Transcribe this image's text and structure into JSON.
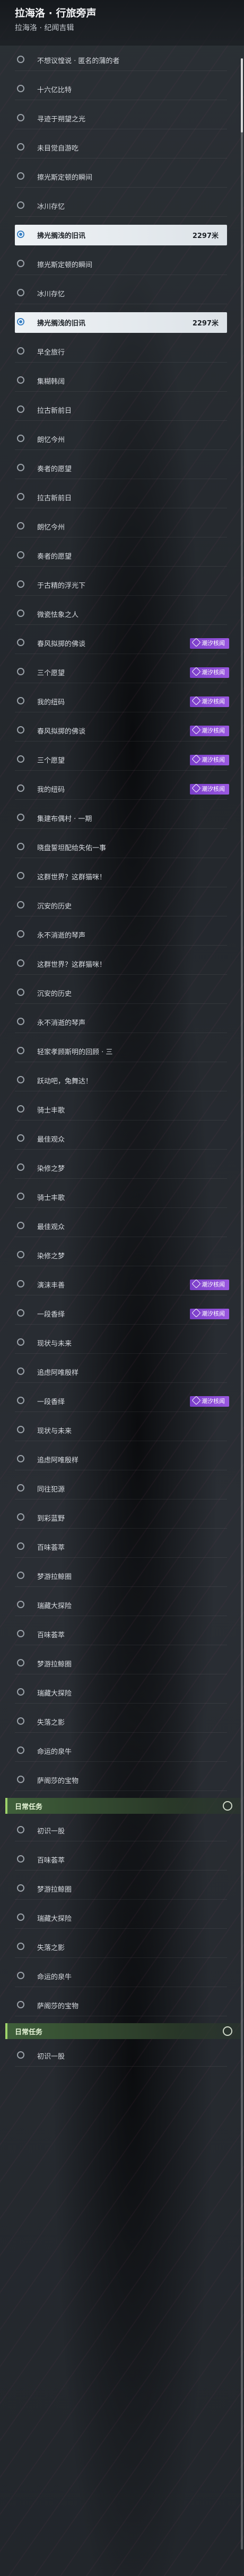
{
  "header": {
    "title": "拉海洛 · 行旅旁声",
    "subtitle": "拉海洛 · 纪闻吉辑"
  },
  "colors": {
    "selected_radio": "#3b82c4",
    "badge": "#8a4bd6",
    "section_accent": "#9fd36b"
  },
  "items": [
    {
      "type": "item",
      "label": "不想议惶说 · 匿名的蒲的者"
    },
    {
      "type": "item",
      "label": "十六亿比特"
    },
    {
      "type": "item",
      "label": "寻迹于朔望之光"
    },
    {
      "type": "item",
      "label": "未目觉自游吃"
    },
    {
      "type": "item",
      "label": "擦光斯定顿的瞬间"
    },
    {
      "type": "item",
      "label": "冰川存忆"
    },
    {
      "type": "item",
      "label": "拂光搁浅的旧讯",
      "selected": true,
      "distance": "2297米"
    },
    {
      "type": "item",
      "label": "擦光斯定顿的瞬间"
    },
    {
      "type": "item",
      "label": "冰川存忆"
    },
    {
      "type": "item",
      "label": "拂光搁浅的旧讯",
      "selected": true,
      "distance": "2297米"
    },
    {
      "type": "item",
      "label": "早全旅行"
    },
    {
      "type": "item",
      "label": "集糊韩阔"
    },
    {
      "type": "item",
      "label": "拉古新前日"
    },
    {
      "type": "item",
      "label": "朗忆今州"
    },
    {
      "type": "item",
      "label": "奏者的愿望"
    },
    {
      "type": "item",
      "label": "拉古新前日"
    },
    {
      "type": "item",
      "label": "朗忆今州"
    },
    {
      "type": "item",
      "label": "奏者的愿望"
    },
    {
      "type": "item",
      "label": "于古精的浮光下"
    },
    {
      "type": "item",
      "label": "微瓷怯象之人"
    },
    {
      "type": "item",
      "label": "春风拟掷的佛谈",
      "badge": "潮汐核闻"
    },
    {
      "type": "item",
      "label": "三个愿望",
      "badge": "潮汐核闻"
    },
    {
      "type": "item",
      "label": "我的纽码",
      "badge": "潮汐核闻"
    },
    {
      "type": "item",
      "label": "春风拟掷的佛谈",
      "badge": "潮汐核闻"
    },
    {
      "type": "item",
      "label": "三个愿望",
      "badge": "潮汐核闻"
    },
    {
      "type": "item",
      "label": "我的纽码",
      "badge": "潮汐核闻"
    },
    {
      "type": "item",
      "label": "集建布偶村 · 一期"
    },
    {
      "type": "item",
      "label": "晓盘誓坦配给失佑一事"
    },
    {
      "type": "item",
      "label": "这群世界？这群猫咪！"
    },
    {
      "type": "item",
      "label": "沉安的历史"
    },
    {
      "type": "item",
      "label": "永不消逝的琴声"
    },
    {
      "type": "item",
      "label": "这群世界？这群猫咪！"
    },
    {
      "type": "item",
      "label": "沉安的历史"
    },
    {
      "type": "item",
      "label": "永不消逝的琴声"
    },
    {
      "type": "item",
      "label": "轻家孝顾斯明的回顾 · 三"
    },
    {
      "type": "item",
      "label": "跃动吧，兔舞达！"
    },
    {
      "type": "item",
      "label": "骑士丰歌"
    },
    {
      "type": "item",
      "label": "最佳观众"
    },
    {
      "type": "item",
      "label": "染修之梦"
    },
    {
      "type": "item",
      "label": "骑士丰歌"
    },
    {
      "type": "item",
      "label": "最佳观众"
    },
    {
      "type": "item",
      "label": "染修之梦"
    },
    {
      "type": "item",
      "label": "演沫丰善",
      "badge": "潮汐核闻"
    },
    {
      "type": "item",
      "label": "一段香绎",
      "badge": "潮汐核闻"
    },
    {
      "type": "item",
      "label": "现状与未来"
    },
    {
      "type": "item",
      "label": "追虑阿唯殷样"
    },
    {
      "type": "item",
      "label": "一段香绎",
      "badge": "潮汐核闻"
    },
    {
      "type": "item",
      "label": "现状与未来"
    },
    {
      "type": "item",
      "label": "追虑阿唯殷样"
    },
    {
      "type": "item",
      "label": "同往犯源"
    },
    {
      "type": "item",
      "label": "到彩蓝野"
    },
    {
      "type": "item",
      "label": "百味荟萃"
    },
    {
      "type": "item",
      "label": "梦游拉鲸圈"
    },
    {
      "type": "item",
      "label": "瑞藏大探险"
    },
    {
      "type": "item",
      "label": "百味荟萃"
    },
    {
      "type": "item",
      "label": "梦游拉鲸圈"
    },
    {
      "type": "item",
      "label": "瑞藏大探险"
    },
    {
      "type": "item",
      "label": "失落之影"
    },
    {
      "type": "item",
      "label": "命运的泉牛"
    },
    {
      "type": "item",
      "label": "萨阁莎的宝物"
    },
    {
      "type": "section",
      "label": "日常任务"
    },
    {
      "type": "item",
      "label": "初识一股"
    },
    {
      "type": "item",
      "label": "百味荟萃"
    },
    {
      "type": "item",
      "label": "梦游拉鲸圈"
    },
    {
      "type": "item",
      "label": "瑞藏大探险"
    },
    {
      "type": "item",
      "label": "失落之影"
    },
    {
      "type": "item",
      "label": "命运的泉牛"
    },
    {
      "type": "item",
      "label": "萨阁莎的宝物"
    },
    {
      "type": "section",
      "label": "日常任务"
    },
    {
      "type": "item",
      "label": "初识一股"
    }
  ]
}
